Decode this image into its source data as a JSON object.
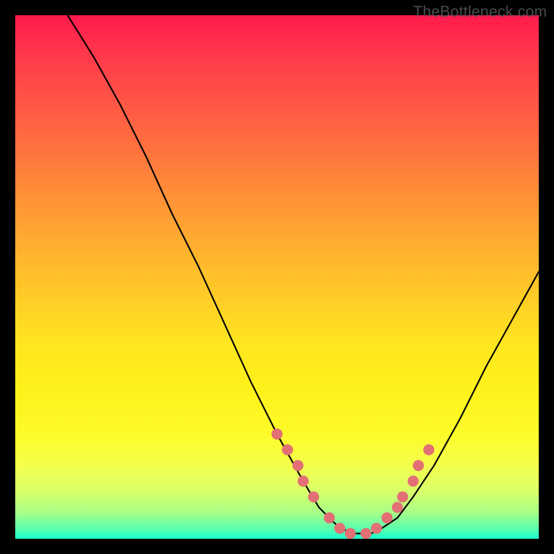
{
  "watermark": "TheBottleneck.com",
  "chart_data": {
    "type": "line",
    "title": "",
    "xlabel": "",
    "ylabel": "",
    "xlim": [
      0,
      100
    ],
    "ylim": [
      0,
      100
    ],
    "gradient_note": "vertical red→yellow→green gradient (heat scale)",
    "curve": {
      "name": "bottleneck-curve",
      "x": [
        10,
        15,
        20,
        25,
        30,
        35,
        40,
        45,
        50,
        55,
        58,
        60,
        62,
        65,
        68,
        70,
        73,
        76,
        80,
        85,
        90,
        95,
        100
      ],
      "y": [
        100,
        92,
        83,
        73,
        62,
        52,
        41,
        30,
        20,
        11,
        6,
        4,
        2,
        1,
        1,
        2,
        4,
        8,
        14,
        23,
        33,
        42,
        51
      ]
    },
    "markers": {
      "name": "curve-samples",
      "color": "#e27074",
      "radius_px": 8,
      "x": [
        50,
        52,
        54,
        55,
        57,
        60,
        62,
        64,
        67,
        69,
        71,
        73,
        74,
        76,
        77,
        79
      ],
      "y": [
        20,
        17,
        14,
        11,
        8,
        4,
        2,
        1,
        1,
        2,
        4,
        6,
        8,
        11,
        14,
        17
      ]
    }
  }
}
